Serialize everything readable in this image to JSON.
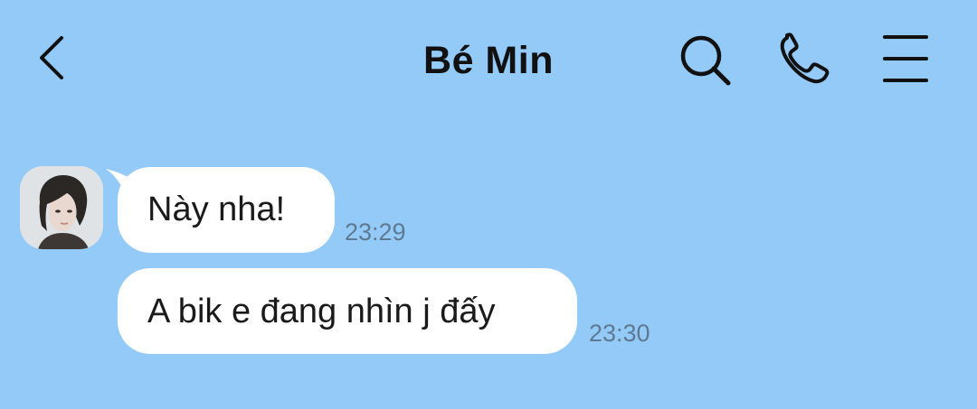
{
  "header": {
    "title": "Bé Min",
    "icons": {
      "back": "back-chevron-icon",
      "search": "search-icon",
      "call": "phone-icon",
      "menu": "menu-icon"
    }
  },
  "colors": {
    "background": "#93caf8",
    "bubble": "#ffffff",
    "timestamp": "#5e7a92"
  },
  "messages": [
    {
      "sender": "Bé Min",
      "text": "Này nha!",
      "time": "23:29"
    },
    {
      "sender": "Bé Min",
      "text": "A bik e đang nhìn j đấy",
      "time": "23:30"
    }
  ]
}
